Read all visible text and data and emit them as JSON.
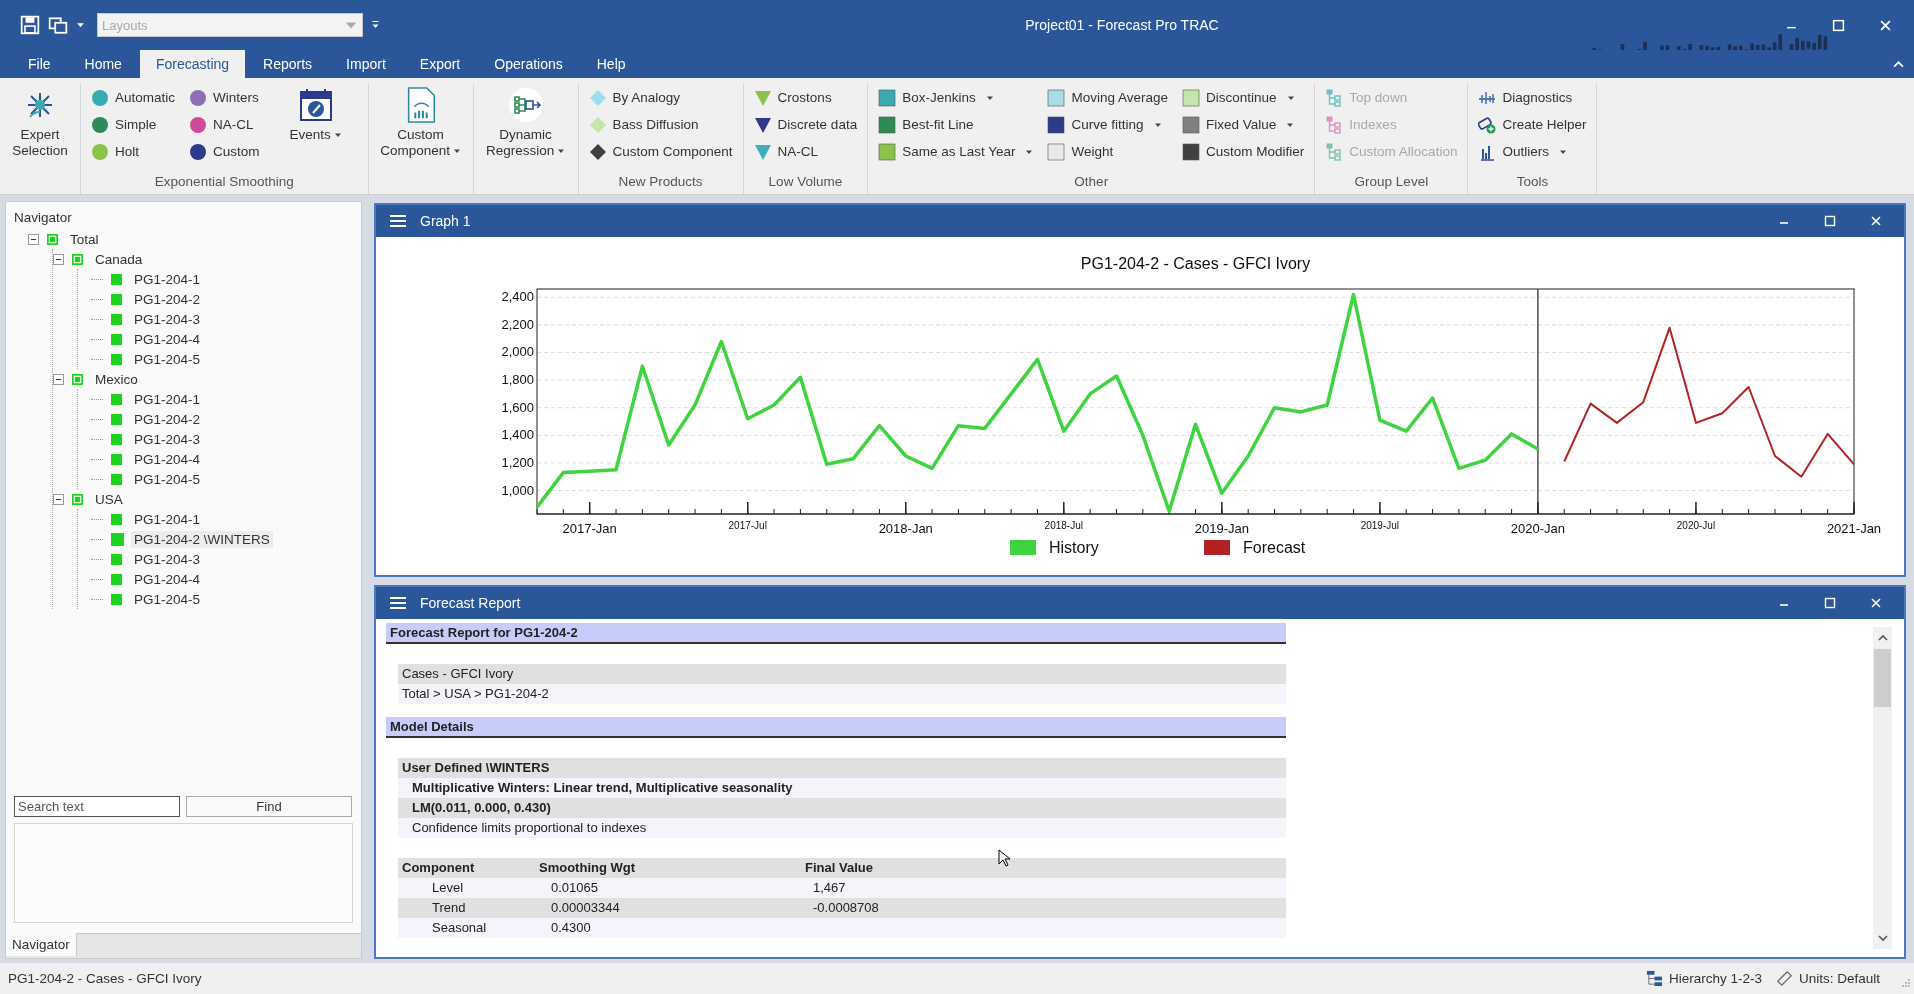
{
  "window": {
    "title": "Project01 - Forecast Pro TRAC"
  },
  "quick_access": {
    "layouts_placeholder": "Layouts"
  },
  "menu_tabs": [
    {
      "label": "File",
      "selected": false
    },
    {
      "label": "Home",
      "selected": false
    },
    {
      "label": "Forecasting",
      "selected": true
    },
    {
      "label": "Reports",
      "selected": false
    },
    {
      "label": "Import",
      "selected": false
    },
    {
      "label": "Export",
      "selected": false
    },
    {
      "label": "Operations",
      "selected": false
    },
    {
      "label": "Help",
      "selected": false
    }
  ],
  "ribbon": {
    "groups": [
      {
        "items": [
          {
            "kind": "large",
            "label": "Expert Selection",
            "dropdown": false
          }
        ]
      },
      {
        "label": "Exponential Smoothing",
        "items": [
          {
            "kind": "stack",
            "buttons": [
              {
                "label": "Automatic",
                "color": "#3aaab0",
                "dropdown": false,
                "disabled": false
              },
              {
                "label": "Simple",
                "color": "#2e8b57",
                "dropdown": false,
                "disabled": false
              },
              {
                "label": "Holt",
                "color": "#8bc34a",
                "dropdown": false,
                "disabled": false
              }
            ]
          },
          {
            "kind": "stack",
            "buttons": [
              {
                "label": "Winters",
                "color": "#8e6fb5",
                "dropdown": false,
                "disabled": false
              },
              {
                "label": "NA-CL",
                "color": "#d04a9a",
                "dropdown": false,
                "disabled": false
              },
              {
                "label": "Custom",
                "color": "#2e3a8c",
                "dropdown": false,
                "disabled": false
              }
            ]
          },
          {
            "kind": "large",
            "label": "Events",
            "dropdown": true
          }
        ]
      },
      {
        "items": [
          {
            "kind": "large",
            "label": "Custom Component",
            "dropdown": true
          }
        ]
      },
      {
        "items": [
          {
            "kind": "large",
            "label": "Dynamic Regression",
            "dropdown": true
          }
        ]
      },
      {
        "label": "New Products",
        "items": [
          {
            "kind": "stack",
            "buttons": [
              {
                "label": "By Analogy",
                "color": "#9fdcec",
                "dropdown": false,
                "disabled": false
              },
              {
                "label": "Bass Diffusion",
                "color": "#c4e6a8",
                "dropdown": false,
                "disabled": false
              },
              {
                "label": "Custom Component",
                "color": "#404040",
                "dropdown": false,
                "disabled": false
              }
            ]
          }
        ]
      },
      {
        "label": "Low Volume",
        "items": [
          {
            "kind": "stack",
            "buttons": [
              {
                "label": "Crostons",
                "color": "#8bc34a",
                "dropdown": false,
                "disabled": false
              },
              {
                "label": "Discrete data",
                "color": "#2e3a8c",
                "dropdown": false,
                "disabled": false
              },
              {
                "label": "NA-CL",
                "color": "#3ab0c0",
                "dropdown": false,
                "disabled": false
              }
            ]
          }
        ]
      },
      {
        "label": "Other",
        "items": [
          {
            "kind": "stack",
            "buttons": [
              {
                "label": "Box-Jenkins",
                "color": "#3aaab0",
                "dropdown": true,
                "disabled": false
              },
              {
                "label": "Best-fit Line",
                "color": "#2e8b57",
                "dropdown": false,
                "disabled": false
              },
              {
                "label": "Same as Last Year",
                "color": "#8bc34a",
                "dropdown": true,
                "disabled": false
              }
            ]
          },
          {
            "kind": "stack",
            "buttons": [
              {
                "label": "Moving Average",
                "color": "#a8dcea",
                "dropdown": false,
                "disabled": false
              },
              {
                "label": "Curve fitting",
                "color": "#2e3a8c",
                "dropdown": true,
                "disabled": false
              },
              {
                "label": "Weight",
                "color": "#e8e8e8",
                "dropdown": false,
                "disabled": false
              }
            ]
          },
          {
            "kind": "stack",
            "buttons": [
              {
                "label": "Discontinue",
                "color": "#c4e6a8",
                "dropdown": true,
                "disabled": false
              },
              {
                "label": "Fixed Value",
                "color": "#808080",
                "dropdown": true,
                "disabled": false
              },
              {
                "label": "Custom Modifier",
                "color": "#404040",
                "dropdown": false,
                "disabled": false
              }
            ]
          }
        ]
      },
      {
        "label": "Group Level",
        "items": [
          {
            "kind": "stack",
            "buttons": [
              {
                "label": "Top down",
                "color": "#6cc0c0",
                "dropdown": false,
                "disabled": true
              },
              {
                "label": "Indexes",
                "color": "#e090c0",
                "dropdown": false,
                "disabled": true
              },
              {
                "label": "Custom Allocation",
                "color": "#80c0b0",
                "dropdown": false,
                "disabled": true
              }
            ]
          }
        ]
      },
      {
        "label": "Tools",
        "items": [
          {
            "kind": "stack",
            "buttons": [
              {
                "label": "Diagnostics",
                "dropdown": false,
                "disabled": false
              },
              {
                "label": "Create Helper",
                "dropdown": false,
                "disabled": false
              },
              {
                "label": "Outliers",
                "dropdown": true,
                "disabled": false
              }
            ]
          }
        ]
      }
    ]
  },
  "navigator": {
    "title": "Navigator",
    "tree": [
      {
        "label": "Total",
        "expanded": true,
        "selected": false,
        "children": [
          {
            "label": "Canada",
            "expanded": true,
            "selected": false,
            "children": [
              {
                "label": "PG1-204-1",
                "selected": false
              },
              {
                "label": "PG1-204-2",
                "selected": false
              },
              {
                "label": "PG1-204-3",
                "selected": false
              },
              {
                "label": "PG1-204-4",
                "selected": false
              },
              {
                "label": "PG1-204-5",
                "selected": false
              }
            ]
          },
          {
            "label": "Mexico",
            "expanded": true,
            "selected": false,
            "children": [
              {
                "label": "PG1-204-1",
                "selected": false
              },
              {
                "label": "PG1-204-2",
                "selected": false
              },
              {
                "label": "PG1-204-3",
                "selected": false
              },
              {
                "label": "PG1-204-4",
                "selected": false
              },
              {
                "label": "PG1-204-5",
                "selected": false
              }
            ]
          },
          {
            "label": "USA",
            "expanded": true,
            "selected": false,
            "children": [
              {
                "label": "PG1-204-1",
                "selected": false
              },
              {
                "label": "PG1-204-2 \\WINTERS",
                "selected": true
              },
              {
                "label": "PG1-204-3",
                "selected": false
              },
              {
                "label": "PG1-204-4",
                "selected": false
              },
              {
                "label": "PG1-204-5",
                "selected": false
              }
            ]
          }
        ]
      }
    ],
    "search_placeholder": "Search text",
    "find_button": "Find",
    "bottom_tab": "Navigator"
  },
  "graph": {
    "title": "Graph 1",
    "chart_data": {
      "type": "line",
      "title": "PG1-204-2 - Cases - GFCI Ivory",
      "categories": [
        null,
        null,
        "2017-Jan",
        null,
        null,
        null,
        null,
        null,
        "2017-Jul",
        null,
        null,
        null,
        null,
        null,
        "2018-Jan",
        null,
        null,
        null,
        null,
        null,
        "2018-Jul",
        null,
        null,
        null,
        null,
        null,
        "2019-Jan",
        null,
        null,
        null,
        null,
        null,
        "2019-Jul",
        null,
        null,
        null,
        null,
        null,
        "2020-Jan",
        null,
        null,
        null,
        null,
        null,
        "2020-Jul",
        null,
        null,
        null,
        null,
        null,
        "2021-Jan"
      ],
      "series": [
        {
          "name": "History",
          "color": "#3fd43f",
          "values": [
            880,
            1130,
            1140,
            1150,
            1900,
            1330,
            1620,
            2080,
            1520,
            1620,
            1820,
            1190,
            1230,
            1470,
            1250,
            1160,
            1470,
            1450,
            1700,
            1950,
            1430,
            1700,
            1830,
            1400,
            850,
            1480,
            980,
            1250,
            1600,
            1570,
            1620,
            2420,
            1510,
            1430,
            1670,
            1160,
            1220,
            1410,
            1300,
            null,
            null,
            null,
            null,
            null,
            null,
            null,
            null,
            null,
            null,
            null,
            null
          ]
        },
        {
          "name": "Forecast",
          "color": "#b22222",
          "values": [
            null,
            null,
            null,
            null,
            null,
            null,
            null,
            null,
            null,
            null,
            null,
            null,
            null,
            null,
            null,
            null,
            null,
            null,
            null,
            null,
            null,
            null,
            null,
            null,
            null,
            null,
            null,
            null,
            null,
            null,
            null,
            null,
            null,
            null,
            null,
            null,
            null,
            null,
            null,
            1210,
            1630,
            1490,
            1640,
            2180,
            1490,
            1560,
            1750,
            1250,
            1100,
            1410,
            1190
          ]
        }
      ],
      "ylim": [
        830,
        2460
      ],
      "yticks": [
        {
          "value": 1000,
          "label": "1,000"
        },
        {
          "value": 1200,
          "label": "1,200"
        },
        {
          "value": 1400,
          "label": "1,400"
        },
        {
          "value": 1600,
          "label": "1,600"
        },
        {
          "value": 1800,
          "label": "1,800"
        },
        {
          "value": 2000,
          "label": "2,000"
        },
        {
          "value": 2200,
          "label": "2,200"
        },
        {
          "value": 2400,
          "label": "2,400"
        }
      ],
      "annotations": [
        {
          "x": "2020-Jan"
        }
      ],
      "grid": true,
      "legend": true
    }
  },
  "report": {
    "title": "Forecast Report",
    "sections": [
      {
        "heading": "Forecast Report for PG1-204-2",
        "lines": [
          {
            "text": "Cases - GFCI Ivory",
            "bold": false
          },
          {
            "text": "Total > USA > PG1-204-2",
            "bold": false
          }
        ]
      },
      {
        "heading": "Model Details",
        "lines": [
          {
            "text": "User Defined \\WINTERS",
            "bold": true,
            "children": [
              {
                "text": "Multiplicative Winters: Linear trend, Multiplicative seasonality",
                "bold": true
              },
              {
                "text": "LM(0.011, 0.000, 0.430)",
                "bold": true
              },
              {
                "text": "Confidence limits proportional to indexes",
                "bold": false
              }
            ]
          }
        ],
        "table": {
          "columns": [
            "Component",
            "Smoothing Wgt",
            "Final Value"
          ],
          "rows": [
            [
              "Level",
              "0.01065",
              "1,467"
            ],
            [
              "Trend",
              "0.00003344",
              "-0.0008708"
            ],
            [
              "Seasonal",
              "0.4300"
            ]
          ]
        }
      }
    ]
  },
  "status_bar": {
    "text": "PG1-204-2 - Cases - GFCI Ivory",
    "items": [
      "Hierarchy 1-2-3",
      "Units: Default"
    ]
  }
}
